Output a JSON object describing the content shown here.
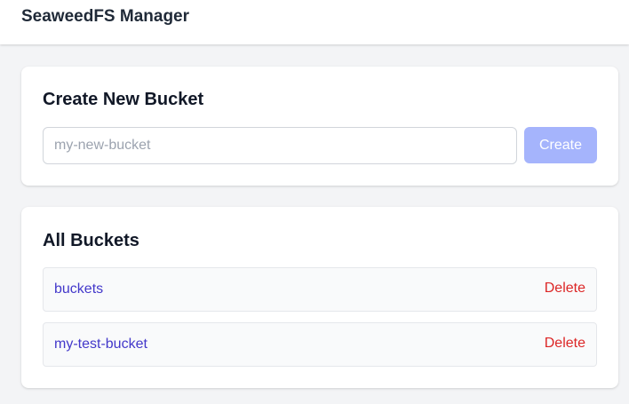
{
  "header": {
    "title": "SeaweedFS Manager"
  },
  "create": {
    "title": "Create New Bucket",
    "input_value": "",
    "input_placeholder": "my-new-bucket",
    "button_label": "Create"
  },
  "list": {
    "title": "All Buckets",
    "buckets": [
      {
        "name": "buckets",
        "delete_label": "Delete"
      },
      {
        "name": "my-test-bucket",
        "delete_label": "Delete"
      }
    ]
  },
  "colors": {
    "background": "#f3f4f6",
    "accent_disabled": "#a5b4fc",
    "link": "#4338ca",
    "danger": "#dc2626"
  }
}
